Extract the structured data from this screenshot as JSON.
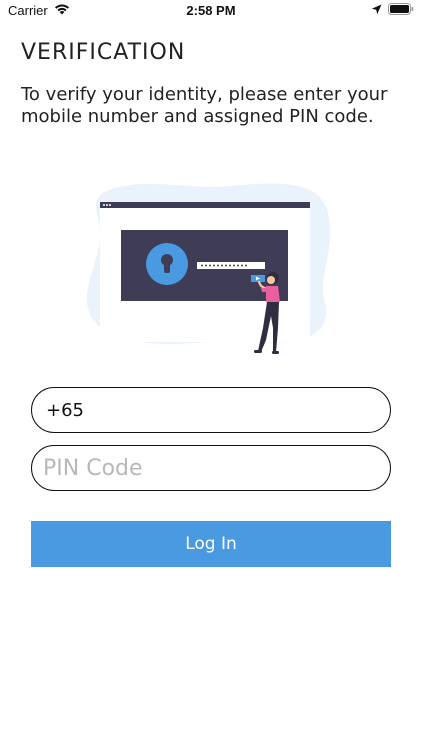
{
  "status_bar": {
    "carrier": "Carrier",
    "time": "2:58 PM"
  },
  "page": {
    "title": "VERIFICATION",
    "subtitle": "To verify your identity, please enter your mobile number and assigned PIN code."
  },
  "form": {
    "phone_value": "+65",
    "pin_placeholder": "PIN Code",
    "login_label": "Log In"
  },
  "colors": {
    "accent": "#4a9ae2",
    "illustration_dark": "#3f3d56",
    "illustration_blob": "#eaf2fb",
    "figure_accent": "#e8609e"
  },
  "icons": [
    "wifi-icon",
    "location-arrow-icon",
    "battery-icon",
    "lock-icon"
  ]
}
